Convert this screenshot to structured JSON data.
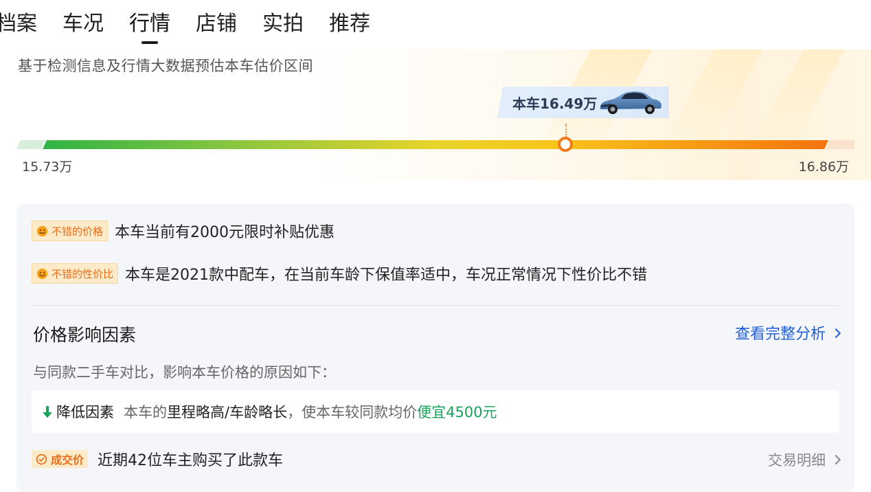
{
  "tabs": [
    {
      "label": "档案"
    },
    {
      "label": "车况"
    },
    {
      "label": "行情",
      "active": true
    },
    {
      "label": "店铺"
    },
    {
      "label": "实拍"
    },
    {
      "label": "推荐"
    }
  ],
  "estimate": {
    "subtitle": "基于检测信息及行情大数据预估本车估价区间",
    "current_label": "本车16.49万",
    "min_label": "15.73万",
    "max_label": "16.86万",
    "min_value": 15.73,
    "max_value": 16.86,
    "current_value": 16.49
  },
  "highlights": [
    {
      "tag": "不错的价格",
      "text": "本车当前有2000元限时补贴优惠"
    },
    {
      "tag": "不错的性价比",
      "text": "本车是2021款中配车，在当前车龄下保值率适中，车况正常情况下性价比不错"
    }
  ],
  "factors": {
    "title": "价格影响因素",
    "link_label": "查看完整分析",
    "description": "与同款二手车对比，影响本车价格的原因如下：",
    "item": {
      "title": "降低因素",
      "prefix": "本车的",
      "strong": "里程略高/车龄略长",
      "middle": "，使本车较同款均价",
      "highlight": "便宜4500元"
    }
  },
  "deal": {
    "badge": "成交价",
    "text": "近期42位车主购买了此款车",
    "link_label": "交易明细"
  },
  "colors": {
    "accent_orange": "#f27a1a",
    "link_blue": "#1f60d8",
    "positive_green": "#19a25a",
    "tag_bg": "#fdeac9"
  }
}
